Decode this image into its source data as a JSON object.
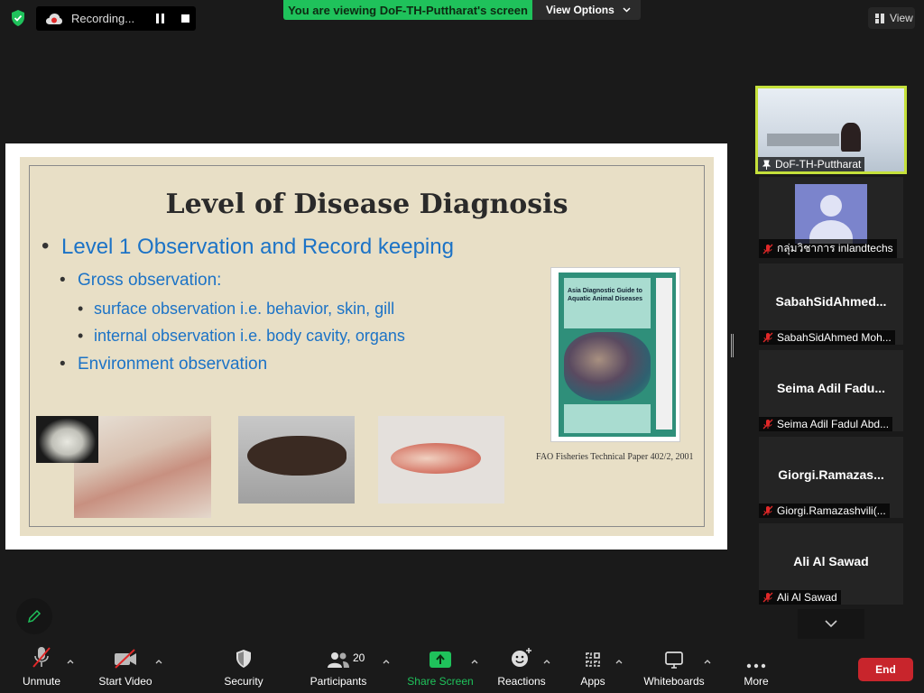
{
  "topbar": {
    "recording_label": "Recording...",
    "viewing_banner": "You are viewing DoF-TH-Puttharat's screen",
    "view_options_label": "View Options",
    "view_label": "View"
  },
  "slide": {
    "title": "Level of Disease Diagnosis",
    "bullets": [
      "Level 1 Observation and Record keeping",
      "Gross observation:",
      "surface observation i.e. behavior, skin, gill",
      "internal observation i.e. body cavity, organs",
      "Environment observation"
    ],
    "book_title": "Asia Diagnostic Guide to Aquatic Animal Diseases",
    "caption": "FAO Fisheries Technical Paper 402/2, 2001"
  },
  "participants_panel": {
    "active_speaker": "DoF-TH-Puttharat",
    "tiles": [
      {
        "display": "",
        "label": "กลุ่มวิชาการ inlandtechs"
      },
      {
        "display": "SabahSidAhmed...",
        "label": "SabahSidAhmed Moh..."
      },
      {
        "display": "Seima Adil Fadu...",
        "label": "Seima Adil Fadul Abd..."
      },
      {
        "display": "Giorgi.Ramazas...",
        "label": "Giorgi.Ramazashvili(..."
      },
      {
        "display": "Ali Al Sawad",
        "label": "Ali Al Sawad"
      }
    ]
  },
  "toolbar": {
    "unmute": "Unmute",
    "start_video": "Start Video",
    "security": "Security",
    "participants": "Participants",
    "participants_count": "20",
    "share_screen": "Share Screen",
    "reactions": "Reactions",
    "apps": "Apps",
    "whiteboards": "Whiteboards",
    "more": "More",
    "end": "End"
  },
  "colors": {
    "share_green": "#1fc25b",
    "active_border": "#c5e13b",
    "end_red": "#c8252c",
    "slide_blue": "#1c73c6",
    "muted_red": "#e02828"
  }
}
